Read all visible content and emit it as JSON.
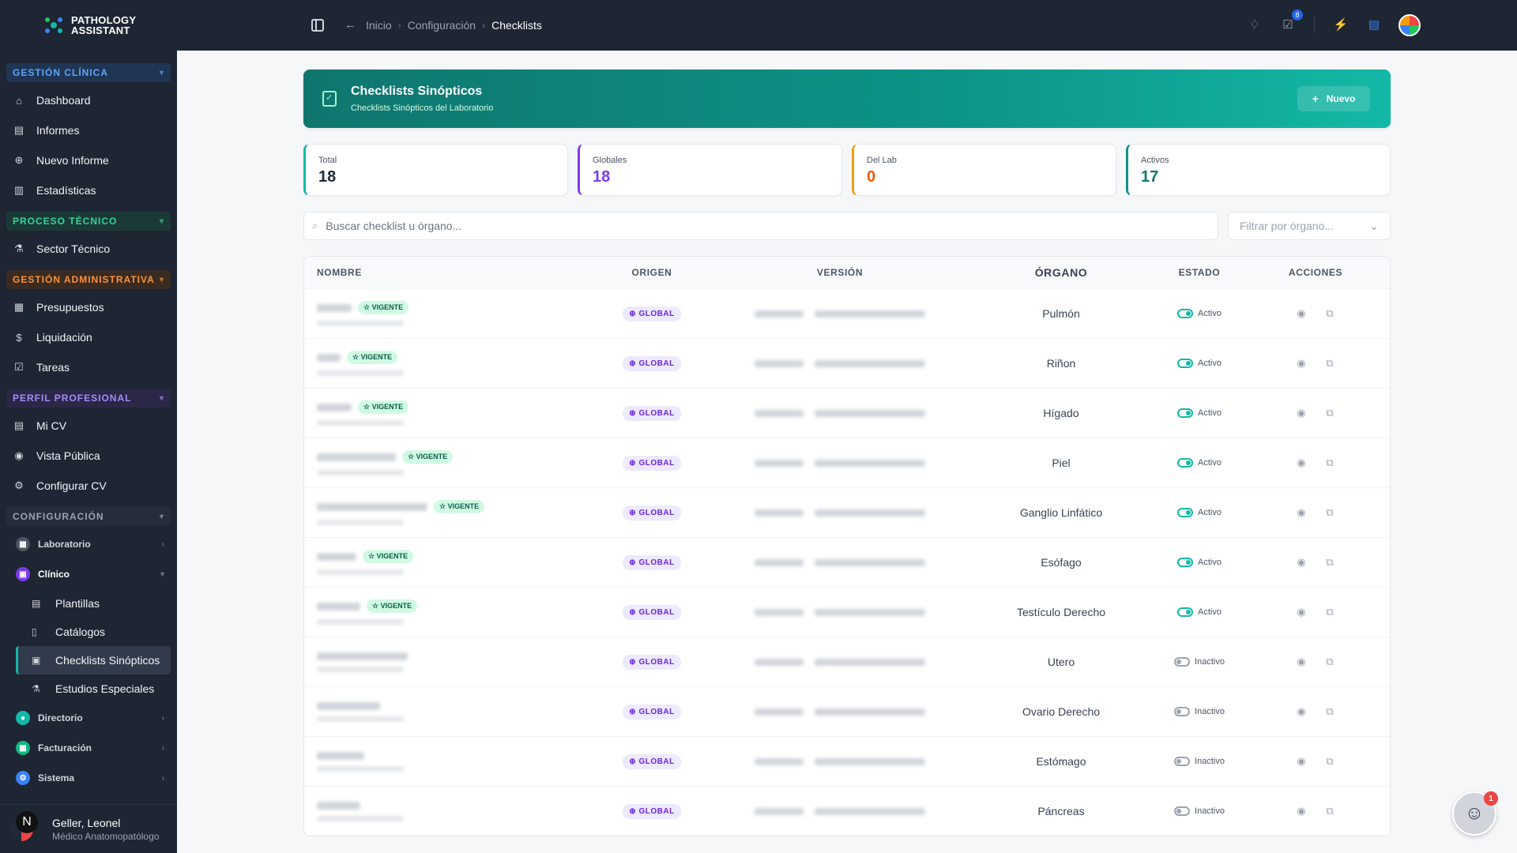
{
  "app": {
    "name_line1": "PATHOLOGY",
    "name_line2": "ASSISTANT"
  },
  "sidebar": {
    "sections": {
      "gestion_clinica": "GESTIÓN CLÍNICA",
      "proceso_tecnico": "PROCESO TÉCNICO",
      "gestion_admin": "GESTIÓN ADMINISTRATIVA",
      "perfil": "PERFIL PROFESIONAL",
      "configuracion": "CONFIGURACIÓN"
    },
    "items": {
      "dashboard": "Dashboard",
      "informes": "Informes",
      "nuevo_informe": "Nuevo Informe",
      "estadisticas": "Estadísticas",
      "sector_tecnico": "Sector Técnico",
      "presupuestos": "Presupuestos",
      "liquidacion": "Liquidación",
      "tareas": "Tareas",
      "mi_cv": "Mi CV",
      "vista_publica": "Vista Pública",
      "configurar_cv": "Configurar CV"
    },
    "groups": {
      "laboratorio": "Laboratorio",
      "clinico": "Clínico",
      "directorio": "Directorio",
      "facturacion": "Facturación",
      "sistema": "Sistema"
    },
    "clinico_sub": {
      "plantillas": "Plantillas",
      "catalogos": "Catálogos",
      "checklists": "Checklists Sinópticos",
      "estudios": "Estudios Especiales"
    },
    "user": {
      "initial": "N",
      "name": "Geller, Leonel",
      "role": "Médico Anatomopatólogo"
    }
  },
  "topbar": {
    "breadcrumb": [
      "Inicio",
      "Configuración",
      "Checklists"
    ],
    "tasks_badge": "8"
  },
  "header": {
    "title": "Checklists Sinópticos",
    "subtitle": "Checklists Sinópticos del Laboratorio",
    "new_button": "Nuevo"
  },
  "stats": {
    "total": {
      "label": "Total",
      "value": "18"
    },
    "globales": {
      "label": "Globales",
      "value": "18"
    },
    "dellab": {
      "label": "Del Lab",
      "value": "0"
    },
    "activos": {
      "label": "Activos",
      "value": "17"
    }
  },
  "filters": {
    "search_placeholder": "Buscar checklist u órgano...",
    "organ_placeholder": "Filtrar por órgano..."
  },
  "table": {
    "columns": {
      "nombre": "NOMBRE",
      "origen": "ORIGEN",
      "version": "VERSIÓN",
      "organo": "ÓRGANO",
      "estado": "ESTADO",
      "acciones": "ACCIONES"
    },
    "rows": [
      {
        "vigente": "VIGENTE",
        "origen": "GLOBAL",
        "organo": "Pulmón",
        "estado": "Activo"
      },
      {
        "vigente": "VIGENTE",
        "origen": "GLOBAL",
        "organo": "Riñon",
        "estado": "Activo"
      },
      {
        "vigente": "VIGENTE",
        "origen": "GLOBAL",
        "organo": "Hígado",
        "estado": "Activo"
      },
      {
        "vigente": "VIGENTE",
        "origen": "GLOBAL",
        "organo": "Piel",
        "estado": "Activo"
      },
      {
        "vigente": "VIGENTE",
        "origen": "GLOBAL",
        "organo": "Ganglio Linfático",
        "estado": "Activo"
      },
      {
        "vigente": "VIGENTE",
        "origen": "GLOBAL",
        "organo": "Esófago",
        "estado": "Activo"
      },
      {
        "vigente": "VIGENTE",
        "origen": "GLOBAL",
        "organo": "Testículo Derecho",
        "estado": "Activo"
      },
      {
        "vigente": "",
        "origen": "GLOBAL",
        "organo": "Utero",
        "estado": "Inactivo"
      },
      {
        "vigente": "",
        "origen": "GLOBAL",
        "organo": "Ovario Derecho",
        "estado": "Inactivo"
      },
      {
        "vigente": "",
        "origen": "GLOBAL",
        "organo": "Estómago",
        "estado": "Inactivo"
      },
      {
        "vigente": "",
        "origen": "GLOBAL",
        "organo": "Páncreas",
        "estado": "Inactivo"
      }
    ]
  },
  "assistant_badge": "1"
}
